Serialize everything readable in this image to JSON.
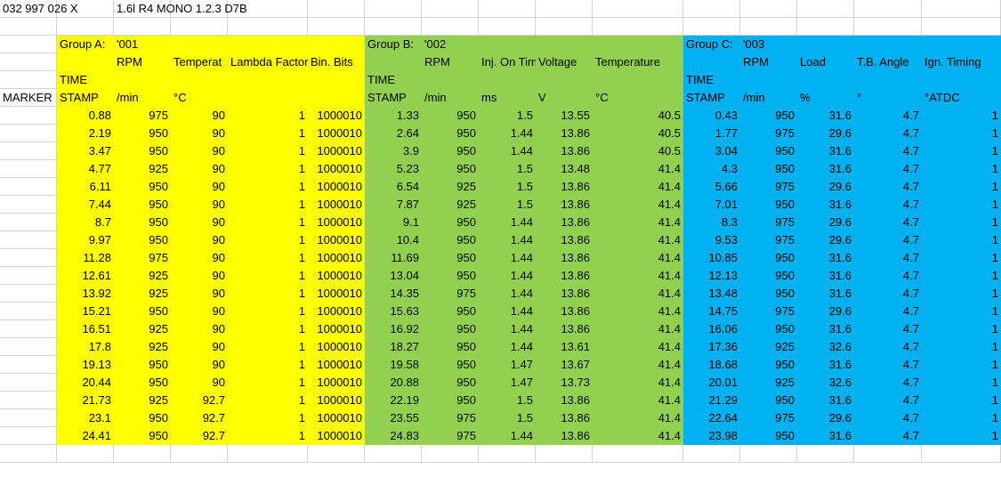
{
  "header": {
    "part_number": "032 997 026 X",
    "engine_desc": "1.6l R4 MONO 1.2.3  D7B"
  },
  "marker_label": "MARKER",
  "groups": [
    {
      "title": "Group A:",
      "code": "'001",
      "color": "#ffff00",
      "time_label_1": "TIME",
      "time_label_2": "STAMP",
      "col_names": [
        "RPM",
        "Temperat",
        "Lambda Factor",
        "Bin. Bits"
      ],
      "units": [
        "/min",
        "°C",
        "",
        ""
      ],
      "rows": [
        [
          "0.88",
          "975",
          "90",
          "1",
          "1000010"
        ],
        [
          "2.19",
          "950",
          "90",
          "1",
          "1000010"
        ],
        [
          "3.47",
          "950",
          "90",
          "1",
          "1000010"
        ],
        [
          "4.77",
          "925",
          "90",
          "1",
          "1000010"
        ],
        [
          "6.11",
          "950",
          "90",
          "1",
          "1000010"
        ],
        [
          "7.44",
          "950",
          "90",
          "1",
          "1000010"
        ],
        [
          "8.7",
          "950",
          "90",
          "1",
          "1000010"
        ],
        [
          "9.97",
          "950",
          "90",
          "1",
          "1000010"
        ],
        [
          "11.28",
          "975",
          "90",
          "1",
          "1000010"
        ],
        [
          "12.61",
          "925",
          "90",
          "1",
          "1000010"
        ],
        [
          "13.92",
          "925",
          "90",
          "1",
          "1000010"
        ],
        [
          "15.21",
          "950",
          "90",
          "1",
          "1000010"
        ],
        [
          "16.51",
          "925",
          "90",
          "1",
          "1000010"
        ],
        [
          "17.8",
          "925",
          "90",
          "1",
          "1000010"
        ],
        [
          "19.13",
          "950",
          "90",
          "1",
          "1000010"
        ],
        [
          "20.44",
          "950",
          "90",
          "1",
          "1000010"
        ],
        [
          "21.73",
          "925",
          "92.7",
          "1",
          "1000010"
        ],
        [
          "23.1",
          "950",
          "92.7",
          "1",
          "1000010"
        ],
        [
          "24.41",
          "950",
          "92.7",
          "1",
          "1000010"
        ]
      ]
    },
    {
      "title": "Group B:",
      "code": "'002",
      "color": "#92d050",
      "time_label_1": "TIME",
      "time_label_2": "STAMP",
      "col_names": [
        "RPM",
        "Inj. On Time",
        "Voltage",
        "Temperature"
      ],
      "units": [
        "/min",
        "ms",
        "V",
        "°C"
      ],
      "rows": [
        [
          "1.33",
          "950",
          "1.5",
          "13.55",
          "40.5"
        ],
        [
          "2.64",
          "950",
          "1.44",
          "13.86",
          "40.5"
        ],
        [
          "3.9",
          "950",
          "1.44",
          "13.86",
          "40.5"
        ],
        [
          "5.23",
          "950",
          "1.5",
          "13.48",
          "41.4"
        ],
        [
          "6.54",
          "925",
          "1.5",
          "13.86",
          "41.4"
        ],
        [
          "7.87",
          "925",
          "1.5",
          "13.86",
          "41.4"
        ],
        [
          "9.1",
          "950",
          "1.44",
          "13.86",
          "41.4"
        ],
        [
          "10.4",
          "950",
          "1.44",
          "13.86",
          "41.4"
        ],
        [
          "11.69",
          "950",
          "1.44",
          "13.86",
          "41.4"
        ],
        [
          "13.04",
          "950",
          "1.44",
          "13.86",
          "41.4"
        ],
        [
          "14.35",
          "975",
          "1.44",
          "13.86",
          "41.4"
        ],
        [
          "15.63",
          "950",
          "1.44",
          "13.86",
          "41.4"
        ],
        [
          "16.92",
          "950",
          "1.44",
          "13.86",
          "41.4"
        ],
        [
          "18.27",
          "950",
          "1.44",
          "13.61",
          "41.4"
        ],
        [
          "19.58",
          "950",
          "1.47",
          "13.67",
          "41.4"
        ],
        [
          "20.88",
          "950",
          "1.47",
          "13.73",
          "41.4"
        ],
        [
          "22.19",
          "950",
          "1.5",
          "13.86",
          "41.4"
        ],
        [
          "23.55",
          "975",
          "1.5",
          "13.86",
          "41.4"
        ],
        [
          "24.83",
          "975",
          "1.44",
          "13.86",
          "41.4"
        ]
      ]
    },
    {
      "title": "Group C:",
      "code": "'003",
      "color": "#00b0f0",
      "time_label_1": "TIME",
      "time_label_2": "STAMP",
      "col_names": [
        "RPM",
        "Load",
        "T.B. Angle",
        "Ign. Timing"
      ],
      "units": [
        "/min",
        "%",
        "°",
        "°ATDC"
      ],
      "rows": [
        [
          "0.43",
          "950",
          "31.6",
          "4.7",
          "1"
        ],
        [
          "1.77",
          "975",
          "29.6",
          "4.7",
          "1"
        ],
        [
          "3.04",
          "950",
          "31.6",
          "4.7",
          "1"
        ],
        [
          "4.3",
          "950",
          "31.6",
          "4.7",
          "1"
        ],
        [
          "5.66",
          "975",
          "29.6",
          "4.7",
          "1"
        ],
        [
          "7.01",
          "950",
          "31.6",
          "4.7",
          "1"
        ],
        [
          "8.3",
          "975",
          "29.6",
          "4.7",
          "1"
        ],
        [
          "9.53",
          "975",
          "29.6",
          "4.7",
          "1"
        ],
        [
          "10.85",
          "950",
          "31.6",
          "4.7",
          "1"
        ],
        [
          "12.13",
          "950",
          "31.6",
          "4.7",
          "1"
        ],
        [
          "13.48",
          "950",
          "31.6",
          "4.7",
          "1"
        ],
        [
          "14.75",
          "975",
          "29.6",
          "4.7",
          "1"
        ],
        [
          "16.06",
          "950",
          "31.6",
          "4.7",
          "1"
        ],
        [
          "17.36",
          "925",
          "32.6",
          "4.7",
          "1"
        ],
        [
          "18.68",
          "950",
          "31.6",
          "4.7",
          "1"
        ],
        [
          "20.01",
          "925",
          "32.6",
          "4.7",
          "1"
        ],
        [
          "21.29",
          "950",
          "31.6",
          "4.7",
          "1"
        ],
        [
          "22.64",
          "975",
          "29.6",
          "4.7",
          "1"
        ],
        [
          "23.98",
          "950",
          "31.6",
          "4.7",
          "1"
        ]
      ]
    }
  ]
}
